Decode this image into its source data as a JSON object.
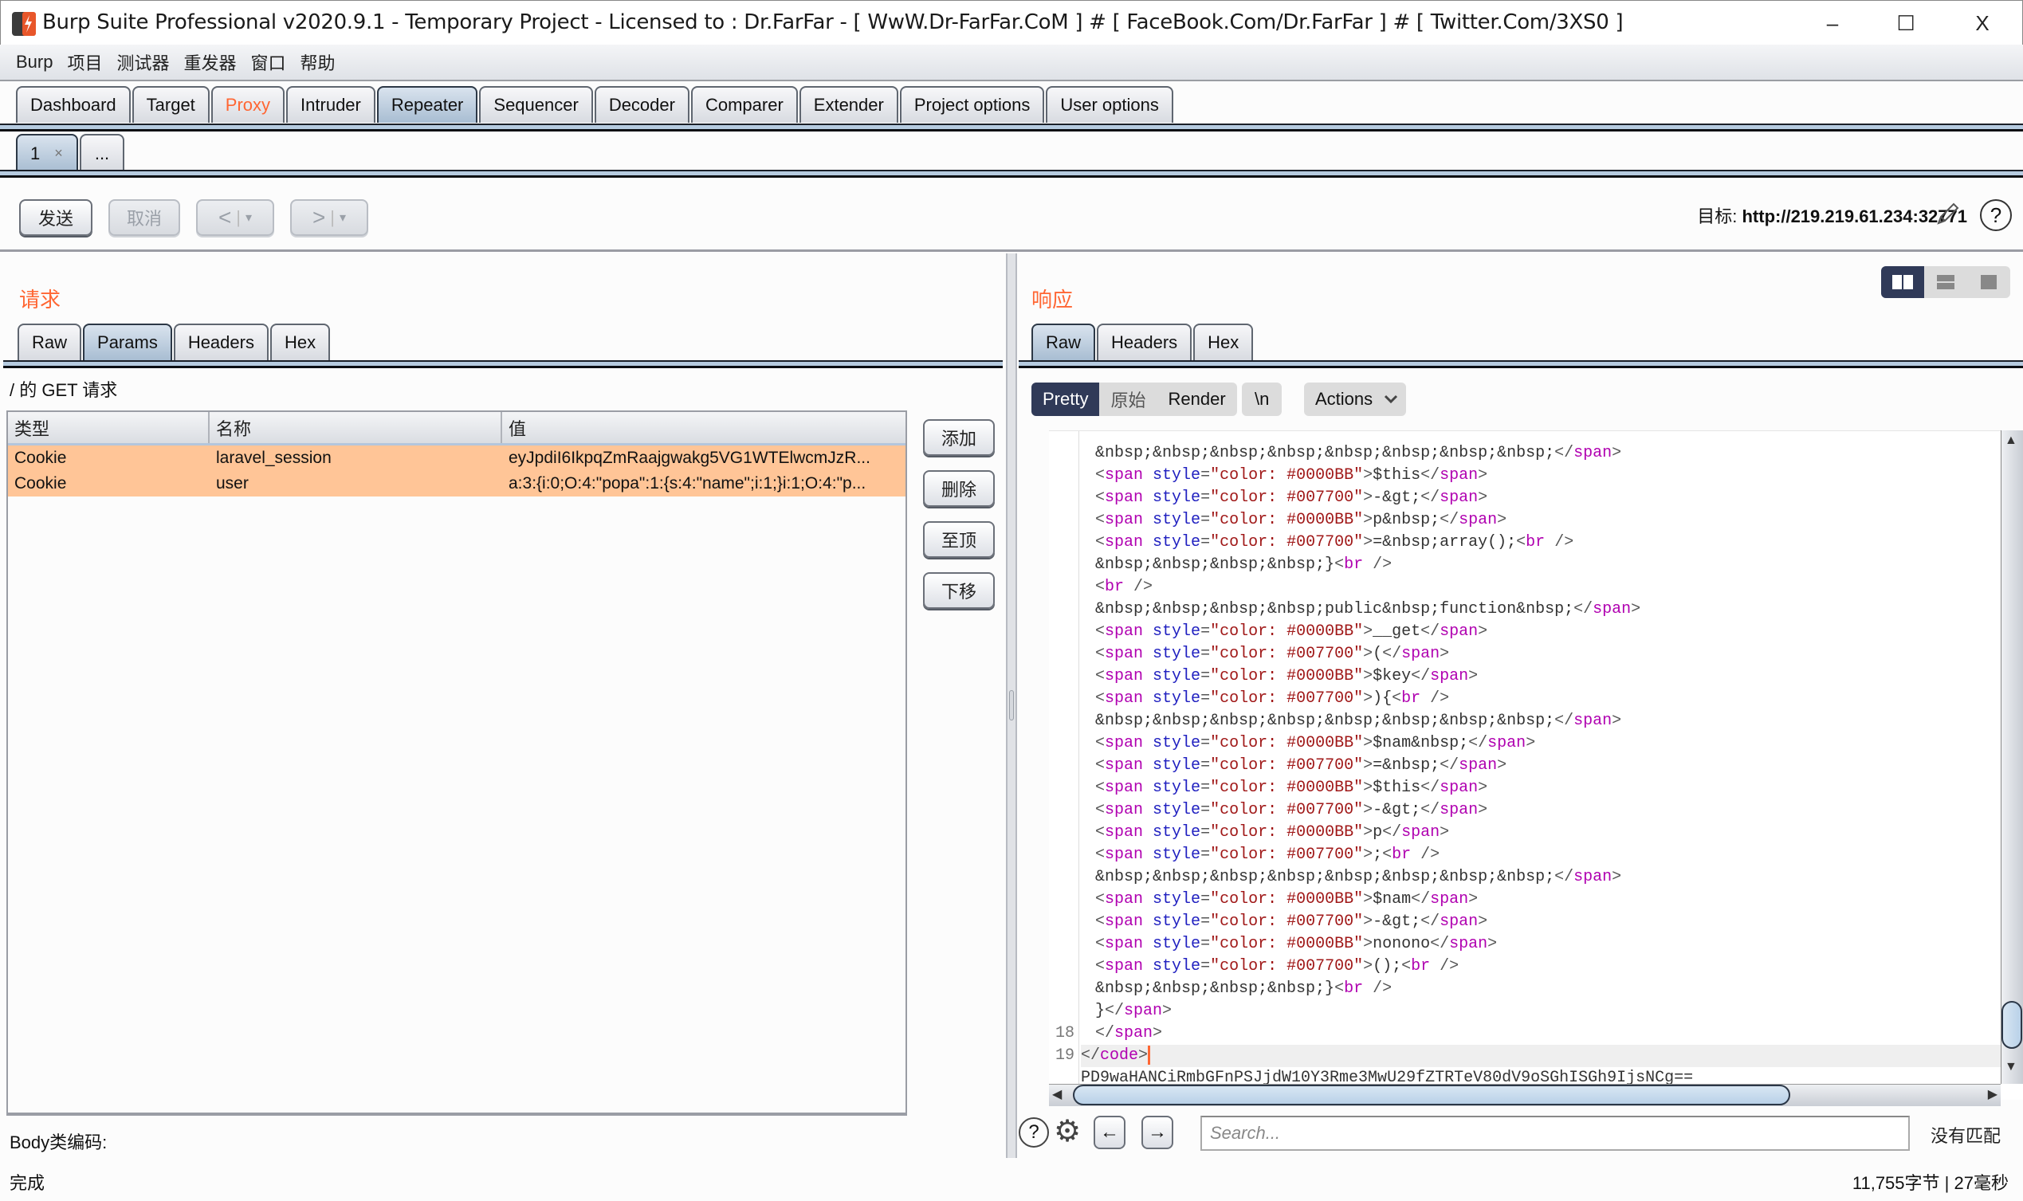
{
  "window": {
    "title": "Burp Suite Professional v2020.9.1 - Temporary Project - Licensed to : Dr.FarFar - [ WwW.Dr-FarFar.CoM ] # [ FaceBook.Com/Dr.FarFar ] # [ Twitter.Com/3XS0 ]",
    "minimize": "–",
    "maximize": "☐",
    "close": "X"
  },
  "menu": [
    "Burp",
    "项目",
    "测试器",
    "重发器",
    "窗口",
    "帮助"
  ],
  "main_tabs": [
    {
      "label": "Dashboard"
    },
    {
      "label": "Target"
    },
    {
      "label": "Proxy",
      "highlight": true
    },
    {
      "label": "Intruder"
    },
    {
      "label": "Repeater",
      "active": true
    },
    {
      "label": "Sequencer"
    },
    {
      "label": "Decoder"
    },
    {
      "label": "Comparer"
    },
    {
      "label": "Extender"
    },
    {
      "label": "Project options"
    },
    {
      "label": "User options"
    }
  ],
  "repeater_tabs": [
    {
      "label": "1",
      "close": "×",
      "active": true
    },
    {
      "label": "..."
    }
  ],
  "toolbar": {
    "send": "发送",
    "cancel": "取消",
    "back": "<",
    "forward": ">",
    "dropdown": "▾",
    "target_label": "目标:",
    "target_url": "http://219.219.61.234:32771",
    "help": "?"
  },
  "request": {
    "title": "请求",
    "tabs": [
      {
        "label": "Raw"
      },
      {
        "label": "Params",
        "active": true
      },
      {
        "label": "Headers"
      },
      {
        "label": "Hex"
      }
    ],
    "caption": "/ 的 GET 请求",
    "columns": [
      "类型",
      "名称",
      "值"
    ],
    "rows": [
      {
        "type": "Cookie",
        "name": "laravel_session",
        "value": "eyJpdiI6IkpqZmRaajgwakg5VG1WTElwcmJzR..."
      },
      {
        "type": "Cookie",
        "name": "user",
        "value": "a:3:{i:0;O:4:\"popa\":1:{s:4:\"name\";i:1;}i:1;O:4:\"p..."
      }
    ],
    "side_buttons": [
      "添加",
      "删除",
      "至顶",
      "下移"
    ],
    "body_encoding_label": "Body类编码:"
  },
  "response": {
    "title": "响应",
    "tabs": [
      {
        "label": "Raw",
        "active": true
      },
      {
        "label": "Headers"
      },
      {
        "label": "Hex"
      }
    ],
    "view_modes": [
      "Pretty",
      "原始",
      "Render"
    ],
    "newline_toggle": "\\n",
    "actions": "Actions",
    "code_lines": [
      {
        "num": "",
        "segs": [
          [
            "x",
            "&nbsp;&nbsp;&nbsp;&nbsp;&nbsp;&nbsp;&nbsp;&nbsp;"
          ],
          [
            "p",
            "</"
          ],
          [
            "n",
            "span"
          ],
          [
            "p",
            ">"
          ]
        ]
      },
      {
        "num": "",
        "tag": "0000BB",
        "text": "$this"
      },
      {
        "num": "",
        "tag": "007700",
        "text": "-&gt;"
      },
      {
        "num": "",
        "tag": "0000BB",
        "text": "p&nbsp;"
      },
      {
        "num": "",
        "tag": "007700",
        "text": "=&nbsp;array();",
        "br": true
      },
      {
        "num": "",
        "segs": [
          [
            "x",
            "&nbsp;&nbsp;&nbsp;&nbsp;}"
          ],
          [
            "p",
            "<"
          ],
          [
            "n",
            "br"
          ],
          [
            "p",
            " />"
          ]
        ]
      },
      {
        "num": "",
        "segs": [
          [
            "p",
            "<"
          ],
          [
            "n",
            "br"
          ],
          [
            "p",
            " />"
          ]
        ]
      },
      {
        "num": "",
        "segs": [
          [
            "x",
            "&nbsp;&nbsp;&nbsp;&nbsp;public&nbsp;function&nbsp;"
          ],
          [
            "p",
            "</"
          ],
          [
            "n",
            "span"
          ],
          [
            "p",
            ">"
          ]
        ]
      },
      {
        "num": "",
        "tag": "0000BB",
        "text": "__get"
      },
      {
        "num": "",
        "tag": "007700",
        "text": "("
      },
      {
        "num": "",
        "tag": "0000BB",
        "text": "$key"
      },
      {
        "num": "",
        "tag": "007700",
        "text": "){",
        "br": true
      },
      {
        "num": "",
        "segs": [
          [
            "x",
            "&nbsp;&nbsp;&nbsp;&nbsp;&nbsp;&nbsp;&nbsp;&nbsp;"
          ],
          [
            "p",
            "</"
          ],
          [
            "n",
            "span"
          ],
          [
            "p",
            ">"
          ]
        ]
      },
      {
        "num": "",
        "tag": "0000BB",
        "text": "$nam&nbsp;"
      },
      {
        "num": "",
        "tag": "007700",
        "text": "=&nbsp;"
      },
      {
        "num": "",
        "tag": "0000BB",
        "text": "$this"
      },
      {
        "num": "",
        "tag": "007700",
        "text": "-&gt;"
      },
      {
        "num": "",
        "tag": "0000BB",
        "text": "p"
      },
      {
        "num": "",
        "tag": "007700",
        "text": ";",
        "br": true
      },
      {
        "num": "",
        "segs": [
          [
            "x",
            "&nbsp;&nbsp;&nbsp;&nbsp;&nbsp;&nbsp;&nbsp;&nbsp;"
          ],
          [
            "p",
            "</"
          ],
          [
            "n",
            "span"
          ],
          [
            "p",
            ">"
          ]
        ]
      },
      {
        "num": "",
        "tag": "0000BB",
        "text": "$nam"
      },
      {
        "num": "",
        "tag": "007700",
        "text": "-&gt;"
      },
      {
        "num": "",
        "tag": "0000BB",
        "text": "nonono"
      },
      {
        "num": "",
        "tag": "007700",
        "text": "();",
        "br": true
      },
      {
        "num": "",
        "segs": [
          [
            "x",
            "&nbsp;&nbsp;&nbsp;&nbsp;}"
          ],
          [
            "p",
            "<"
          ],
          [
            "n",
            "br"
          ],
          [
            "p",
            " />"
          ]
        ]
      },
      {
        "num": "",
        "segs": [
          [
            "x",
            "}"
          ],
          [
            "p",
            "</"
          ],
          [
            "n",
            "span"
          ],
          [
            "p",
            ">"
          ]
        ]
      },
      {
        "num": "18",
        "segs": [
          [
            "p",
            "</"
          ],
          [
            "n",
            "span"
          ],
          [
            "p",
            ">"
          ]
        ]
      },
      {
        "num": "19",
        "outdent": true,
        "current": true,
        "segs": [
          [
            "p",
            "</"
          ],
          [
            "n",
            "code"
          ],
          [
            "p",
            ">"
          ]
        ]
      },
      {
        "num": "",
        "outdent": true,
        "segs": [
          [
            "x",
            "PD9waHANCiRmbGFnPSJjdW10Y3Rme3MwU29fZTRTeV80dV9oSGhISGh9IjsNCg=="
          ]
        ]
      }
    ],
    "search_placeholder": "Search...",
    "search_value": "",
    "match_status": "没有匹配",
    "nav_prev": "←",
    "nav_next": "→"
  },
  "status": {
    "left": "完成",
    "size": "11,755",
    "size_unit": "字节",
    "separator": " | ",
    "time": "27",
    "time_unit": "毫秒"
  },
  "colors": {
    "accent": "#ff6633",
    "selected_row": "#ffc597",
    "active_toggle": "#303a58",
    "php_keyword": "#0000BB",
    "php_operator": "#007700"
  }
}
